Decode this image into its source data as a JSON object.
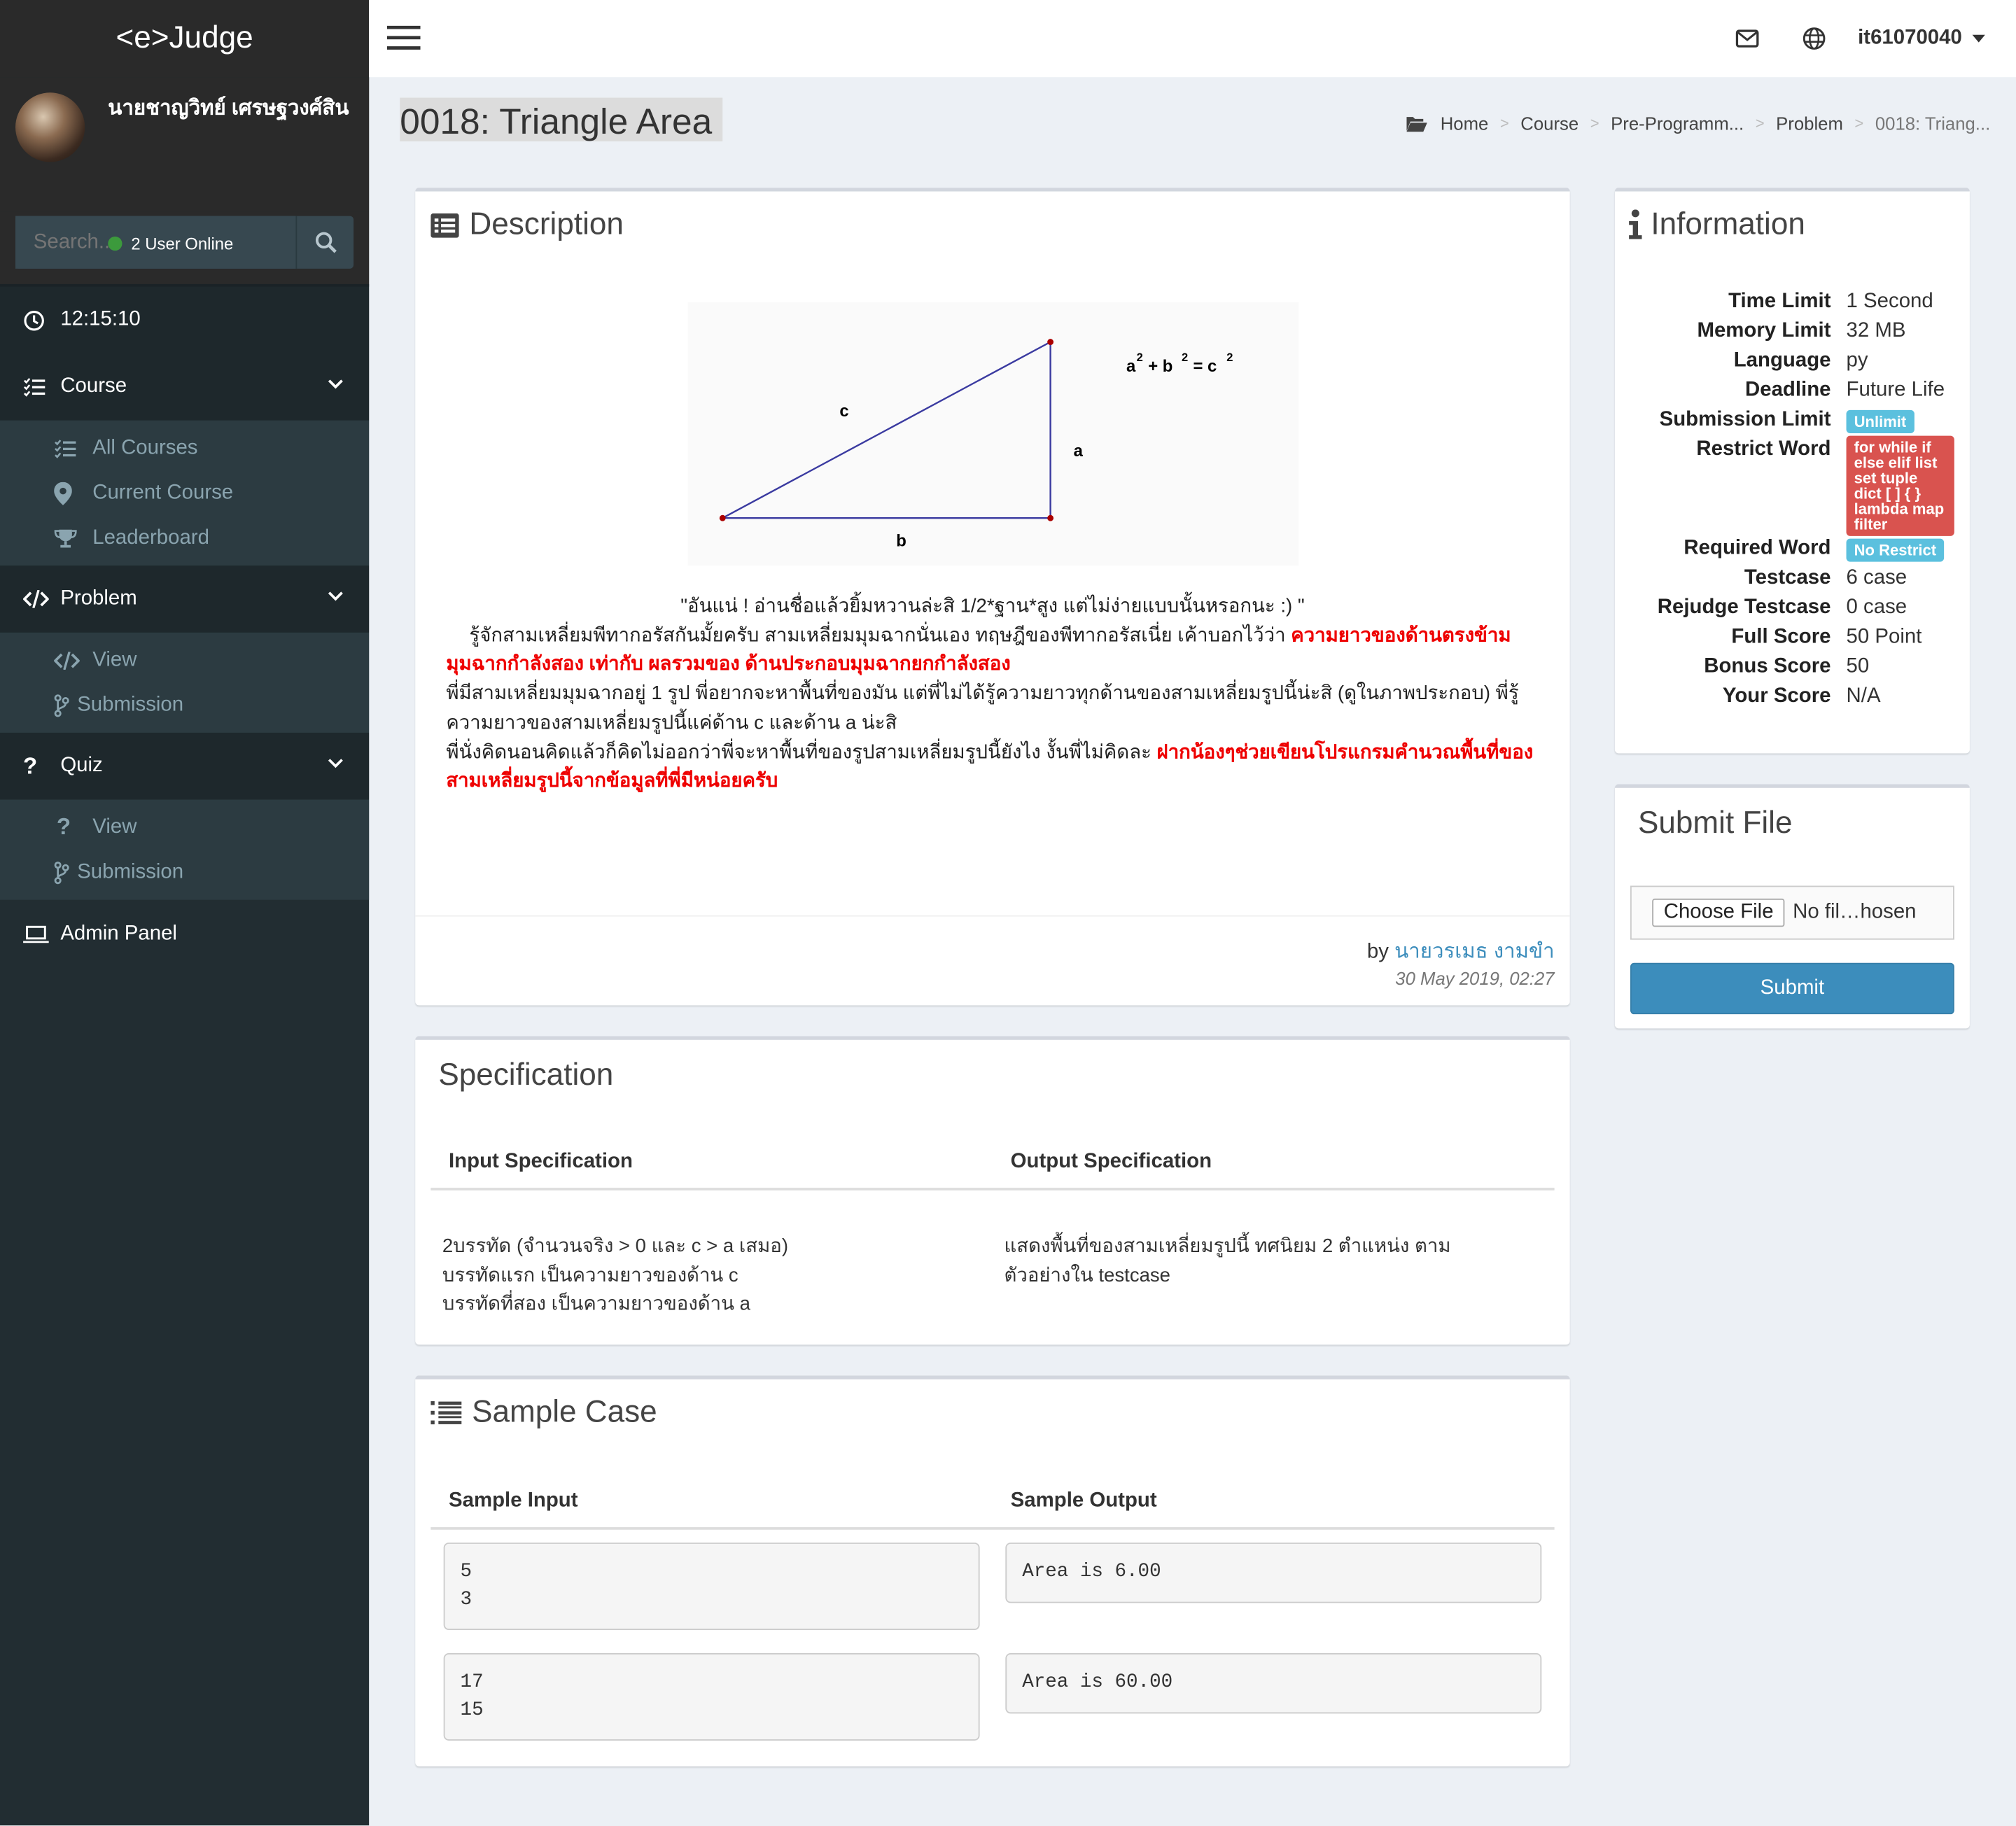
{
  "app": {
    "logo": "<e>Judge"
  },
  "user": {
    "name": "นายชาญวิทย์ เศรษฐวงศ์สิน",
    "online": "2 User Online",
    "account": "it61070040"
  },
  "search": {
    "placeholder": "Search..."
  },
  "clock": "12:15:10",
  "sidebar": {
    "course": {
      "label": "Course",
      "items": [
        "All Courses",
        "Current Course",
        "Leaderboard"
      ]
    },
    "problem": {
      "label": "Problem",
      "items": [
        "View",
        "Submission"
      ]
    },
    "quiz": {
      "label": "Quiz",
      "items": [
        "View",
        "Submission"
      ]
    },
    "admin": "Admin Panel"
  },
  "page": {
    "title": "0018: Triangle Area"
  },
  "breadcrumb": [
    "Home",
    "Course",
    "Pre-Programm...",
    "Problem",
    "0018: Triang..."
  ],
  "description": {
    "heading": "Description",
    "figure": {
      "formula_a": "a",
      "formula_plus": "+ b",
      "formula_eq": "= c",
      "sq": "2",
      "label_a": "a",
      "label_b": "b",
      "label_c": "c"
    },
    "quote": "\"อันแน่ ! อ่านชื่อแล้วยิ้มหวานล่ะสิ 1/2*ฐาน*สูง แต่ไม่ง่ายแบบนั้นหรอกนะ :) \"",
    "p1": "รู้จักสามเหลี่ยมพีทากอรัสกันมั้ยครับ สามเหลี่ยมมุมฉากนั่นเอง ทฤษฎีของพีทากอรัสเนี่ย เค้าบอกไว้ว่า ",
    "p1_red": "ความยาวของด้านตรงข้ามมุมฉากกำลังสอง เท่ากับ ผลรวมของ ด้านประกอบมุมฉากยกกำลังสอง",
    "p2": "พี่มีสามเหลี่ยมมุมฉากอยู่ 1 รูป พี่อยากจะหาพื้นที่ของมัน แต่พี่ไม่ได้รู้ความยาวทุกด้านของสามเหลี่ยมรูปนี้น่ะสิ (ดูในภาพประกอบ) พี่รู้ความยาวของสามเหลี่ยมรูปนี้แค่ด้าน c และด้าน a น่ะสิ",
    "p3": "พี่นั่งคิดนอนคิดแล้วก็คิดไม่ออกว่าพี่จะหาพื้นที่ของรูปสามเหลี่ยมรูปนี้ยังไง งั้นพี่ไม่คิดละ ",
    "p3_red": "ฝากน้องๆช่วยเขียนโปรแกรมคำนวณพื้นที่ของสามเหลี่ยมรูปนี้จากข้อมูลที่พี่มีหน่อยครับ",
    "by_label": "by",
    "author": "นายวรเมธ งามขำ",
    "date": "30 May 2019, 02:27"
  },
  "specification": {
    "heading": "Specification",
    "input_header": "Input Specification",
    "output_header": "Output Specification",
    "input_lines": [
      "2บรรทัด (จำนวนจริง > 0 และ c > a เสมอ)",
      "บรรทัดแรก เป็นความยาวของด้าน c",
      "บรรทัดที่สอง เป็นความยาวของด้าน a"
    ],
    "output_lines": [
      "แสดงพื้นที่ของสามเหลี่ยมรูปนี้ ทศนิยม 2 ตำแหน่ง ตาม",
      "ตัวอย่างใน testcase"
    ]
  },
  "sample": {
    "heading": "Sample Case",
    "input_header": "Sample Input",
    "output_header": "Sample Output",
    "cases": [
      {
        "input": "5\n3",
        "output": "Area is 6.00"
      },
      {
        "input": "17\n15",
        "output": "Area is 60.00"
      }
    ]
  },
  "information": {
    "heading": "Information",
    "rows": [
      {
        "k": "Time Limit",
        "v": "1 Second"
      },
      {
        "k": "Memory Limit",
        "v": "32 MB"
      },
      {
        "k": "Language",
        "v": "py"
      },
      {
        "k": "Deadline",
        "v": "Future Life"
      },
      {
        "k": "Submission Limit",
        "v": "Unlimit"
      },
      {
        "k": "Restrict Word",
        "v": "for while if else elif list set tuple dict [ ] { } lambda map filter"
      },
      {
        "k": "Required Word",
        "v": "No Restrict"
      },
      {
        "k": "Testcase",
        "v": "6 case"
      },
      {
        "k": "Rejudge Testcase",
        "v": "0 case"
      },
      {
        "k": "Full Score",
        "v": "50 Point"
      },
      {
        "k": "Bonus Score",
        "v": "50"
      },
      {
        "k": "Your Score",
        "v": "N/A"
      }
    ],
    "colors": {
      "info_label": "#5bc0de",
      "danger_label": "#d9534f"
    }
  },
  "submit": {
    "heading": "Submit File",
    "choose": "Choose File",
    "nofile": "No fil…hosen",
    "button": "Submit"
  },
  "theme": {
    "sidebar": "#222d32",
    "accent": "#3c8dbc"
  }
}
